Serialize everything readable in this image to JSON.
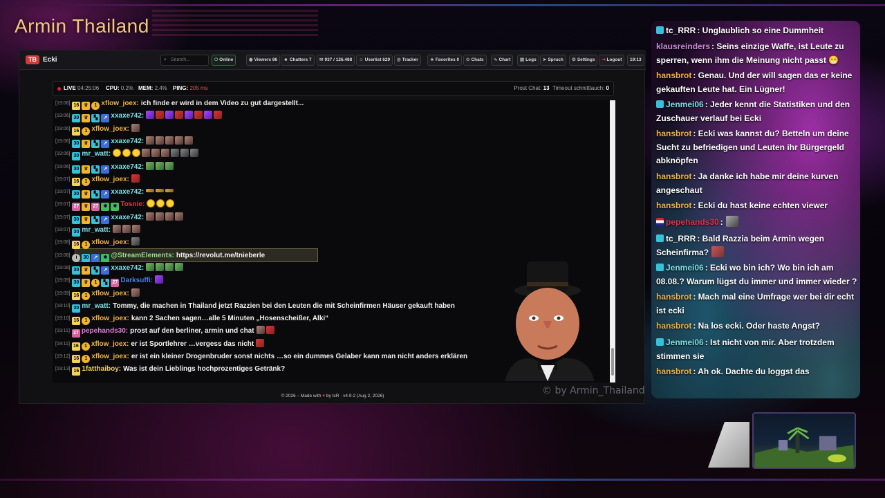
{
  "overlay": {
    "streamer_title": "Armin Thailand",
    "watermark": "© by Armin_Thailand"
  },
  "topbar": {
    "logo": "TB",
    "channel": "Ecki",
    "search_placeholder": "Search...",
    "buttons": [
      {
        "icon": "online-icon",
        "label": "Online"
      },
      {
        "icon": "eye-icon",
        "label": "Viewers  86"
      },
      {
        "icon": "users-icon",
        "label": "Chatters  7"
      },
      {
        "icon": "chat-bubble-icon",
        "label": "937 / 126.488"
      },
      {
        "icon": "user-icon",
        "label": "Userlist  629"
      },
      {
        "icon": "tracker-icon",
        "label": "Tracker"
      },
      {
        "icon": "star-icon",
        "label": "Favorites  0"
      },
      {
        "icon": "chats-icon",
        "label": "Chats"
      },
      {
        "icon": "chart-icon",
        "label": "Chart"
      },
      {
        "icon": "logs-icon",
        "label": "Logs"
      },
      {
        "icon": "spruch-icon",
        "label": "Spruch"
      },
      {
        "icon": "gear-icon",
        "label": "Settings"
      },
      {
        "icon": "logout-icon",
        "label": "Logout"
      }
    ],
    "clock": "19:13"
  },
  "status": {
    "live_label": "LIVE",
    "live_value": "04:25:06",
    "cpu_label": "CPU:",
    "cpu_value": "0.2%",
    "mem_label": "MEM:",
    "mem_value": "2.4%",
    "ping_label": "PING:",
    "ping_value": "205 ms",
    "prost_label": "Prost Chat:",
    "prost_value": "13",
    "timeout_label": "Timeout schnittlauch:",
    "timeout_value": "0"
  },
  "chatlog": [
    {
      "time": "[19:06]",
      "badges": [
        "b-sub",
        "b-crown",
        "b-gold"
      ],
      "user": "xflow_joex:",
      "color": "#f0b347",
      "text": "ich finde er wird in dem Video zu gut dargestellt...",
      "emotes": []
    },
    {
      "time": "[19:06]",
      "badges": [
        "b-teal",
        "b-crown",
        "b-vip",
        "b-blue"
      ],
      "user": "xxaxe742:",
      "color": "#7fe0e6",
      "text": "",
      "emotes": [
        "e-purple",
        "e-red",
        "e-purple",
        "e-red",
        "e-purple",
        "e-red",
        "e-purple",
        "e-red"
      ]
    },
    {
      "time": "[19:06]",
      "badges": [
        "b-sub",
        "b-gold"
      ],
      "user": "xflow_joex:",
      "color": "#f0b347",
      "text": "",
      "emotes": [
        "e-brown"
      ]
    },
    {
      "time": "[19:06]",
      "badges": [
        "b-teal",
        "b-crown",
        "b-vip",
        "b-blue"
      ],
      "user": "xxaxe742:",
      "color": "#7fe0e6",
      "text": "",
      "emotes": [
        "e-brown",
        "e-brown",
        "e-brown",
        "e-brown",
        "e-brown"
      ]
    },
    {
      "time": "[19:06]",
      "badges": [
        "b-teal"
      ],
      "user": "mr_watt:",
      "color": "#7fe0e6",
      "text": "",
      "emotes": [
        "e-yellow",
        "e-yellow",
        "e-yellow",
        "e-brown",
        "e-brown",
        "e-brown",
        "e-gray",
        "e-gray",
        "e-gray"
      ]
    },
    {
      "time": "[19:06]",
      "badges": [
        "b-teal",
        "b-crown",
        "b-vip",
        "b-blue"
      ],
      "user": "xxaxe742:",
      "color": "#7fe0e6",
      "text": "",
      "emotes": [
        "e-green",
        "e-green",
        "e-green"
      ]
    },
    {
      "time": "[19:07]",
      "badges": [
        "b-sub",
        "b-gold"
      ],
      "user": "xflow_joex:",
      "color": "#f0b347",
      "text": "",
      "emotes": [
        "e-red"
      ]
    },
    {
      "time": "[19:07]",
      "badges": [
        "b-teal",
        "b-crown",
        "b-vip",
        "b-blue"
      ],
      "user": "xxaxe742:",
      "color": "#7fe0e6",
      "text": "",
      "emotes": [
        "e-gold",
        "e-gold",
        "e-gold"
      ]
    },
    {
      "time": "[19:07]",
      "badges": [
        "b-pink",
        "b-crown",
        "b-pink",
        "b-green-e",
        "b-green-e"
      ],
      "user": "Tosnie:",
      "color": "#e0304a",
      "text": "",
      "emotes": [
        "e-yellow",
        "e-yellow",
        "e-yellow"
      ]
    },
    {
      "time": "[19:07]",
      "badges": [
        "b-teal",
        "b-crown",
        "b-vip",
        "b-blue"
      ],
      "user": "xxaxe742:",
      "color": "#7fe0e6",
      "text": "",
      "emotes": [
        "e-brown",
        "e-brown",
        "e-brown",
        "e-brown"
      ]
    },
    {
      "time": "[19:07]",
      "badges": [
        "b-teal"
      ],
      "user": "mr_watt:",
      "color": "#7fe0e6",
      "text": "",
      "emotes": [
        "e-brown",
        "e-brown",
        "e-brown"
      ]
    },
    {
      "time": "[19:08]",
      "badges": [
        "b-sub",
        "b-gold"
      ],
      "user": "xflow_joex:",
      "color": "#f0b347",
      "text": "",
      "emotes": [
        "e-gray"
      ]
    },
    {
      "time": "[19:08]",
      "badges": [
        "b-gray",
        "b-teal",
        "b-blue",
        "b-green-e"
      ],
      "user": "@StreamElements:",
      "color": "#8fe08f",
      "text": "https://revolut.me/tnieberle",
      "emotes": [],
      "highlight": true
    },
    {
      "time": "[19:08]",
      "badges": [
        "b-teal",
        "b-crown",
        "b-vip",
        "b-blue"
      ],
      "user": "xxaxe742:",
      "color": "#7fe0e6",
      "text": "",
      "emotes": [
        "e-green",
        "e-green",
        "e-green",
        "e-green"
      ]
    },
    {
      "time": "[19:09]",
      "badges": [
        "b-teal",
        "b-crown",
        "b-gold",
        "b-vip",
        "b-pink"
      ],
      "user": "Darksuffi:",
      "color": "#4a7ee0",
      "text": "",
      "emotes": [
        "e-purple"
      ]
    },
    {
      "time": "[19:09]",
      "badges": [
        "b-sub",
        "b-gold"
      ],
      "user": "xflow_joex:",
      "color": "#f0b347",
      "text": "",
      "emotes": [
        "e-brown"
      ]
    },
    {
      "time": "[19:10]",
      "badges": [
        "b-teal"
      ],
      "user": "mr_watt:",
      "color": "#7fe0e6",
      "text": "Tommy, die machen in Thailand jetzt Razzien bei den Leuten die mit Scheinfirmen Häuser gekauft haben",
      "emotes": []
    },
    {
      "time": "[19:10]",
      "badges": [
        "b-sub",
        "b-gold"
      ],
      "user": "xflow_joex:",
      "color": "#f0b347",
      "text": "kann 2 Sachen sagen…alle 5 Minuten „Hosenscheißer, Alki“",
      "emotes": []
    },
    {
      "time": "[19:11]",
      "badges": [
        "b-pink"
      ],
      "user": "pepehands30:",
      "color": "#e07ad6",
      "text": "prost auf den berliner, armin und chat",
      "emotes": [
        "e-brown",
        "e-red"
      ]
    },
    {
      "time": "[19:11]",
      "badges": [
        "b-sub",
        "b-gold"
      ],
      "user": "xflow_joex:",
      "color": "#f0b347",
      "text": "er ist Sportlehrer …vergess das nicht",
      "emotes": [
        "e-red"
      ]
    },
    {
      "time": "[19:12]",
      "badges": [
        "b-sub",
        "b-gold"
      ],
      "user": "xflow_joex:",
      "color": "#f0b347",
      "text": "er ist ein kleiner Drogenbruder sonst nichts …so ein dummes Gelaber kann man nicht anders erklären",
      "emotes": []
    },
    {
      "time": "[19:13]",
      "badges": [
        "b-sub"
      ],
      "user": "1fatthaiboy:",
      "color": "#f0d25a",
      "text": "Was ist dein Lieblings hochprozentiges Getränk?",
      "emotes": []
    }
  ],
  "footer": {
    "left": "© 2026 – Made with",
    "right": "by tcR · v4.9-2 (Aug 2, 2026)"
  },
  "sidechat": [
    {
      "user": "tc_RRR",
      "cls": "u-red",
      "badge": "teal",
      "text": ": Unglaublich so eine Dummheit"
    },
    {
      "user": "klausreinders",
      "cls": "u-klaus",
      "badge": "",
      "text": ": Seins einzige Waffe, ist Leute zu sperren, wenn ihm die Meinung nicht passt 😁"
    },
    {
      "user": "hansbrot",
      "cls": "u-hans",
      "badge": "",
      "text": ": Genau. Und der will sagen das er keine gekauften Leute hat. Ein Lügner!"
    },
    {
      "user": "Jenmei06",
      "cls": "u-jen",
      "badge": "teal",
      "text": ": Jeder kennt die Statistiken und den Zuschauer verlauf bei Ecki"
    },
    {
      "user": "hansbrot",
      "cls": "u-hans",
      "badge": "",
      "text": ": Ecki was kannst du? Betteln um deine Sucht zu befriedigen und Leuten ihr Bürgergeld abknöpfen"
    },
    {
      "user": "hansbrot",
      "cls": "u-hans",
      "badge": "",
      "text": ": Ja danke ich habe mir deine kurven angeschaut"
    },
    {
      "user": "hansbrot",
      "cls": "u-hans",
      "badge": "",
      "text": ": Ecki du hast keine echten viewer"
    },
    {
      "user": "pepehands30",
      "cls": "u-pepe",
      "badge": "flag",
      "text": ":"
    },
    {
      "user": "tc_RRR",
      "cls": "u-red",
      "badge": "teal",
      "text": ": Bald Razzia beim Armin wegen Scheinfirma?"
    },
    {
      "user": "Jenmei06",
      "cls": "u-jen",
      "badge": "teal",
      "text": ": Ecki wo bin ich? Wo bin ich am 08.08.? Warum lügst du immer und immer wieder ?"
    },
    {
      "user": "hansbrot",
      "cls": "u-hans",
      "badge": "",
      "text": ": Mach mal eine Umfrage wer bei dir echt ist ecki"
    },
    {
      "user": "hansbrot",
      "cls": "u-hans",
      "badge": "",
      "text": ": Na los ecki. Oder haste Angst?"
    },
    {
      "user": "Jenmei06",
      "cls": "u-jen",
      "badge": "teal",
      "text": ": Ist nicht von mir. Aber trotzdem stimmen sie"
    },
    {
      "user": "hansbrot",
      "cls": "u-hans",
      "badge": "",
      "text": ": Ah ok. Dachte du loggst das"
    }
  ]
}
